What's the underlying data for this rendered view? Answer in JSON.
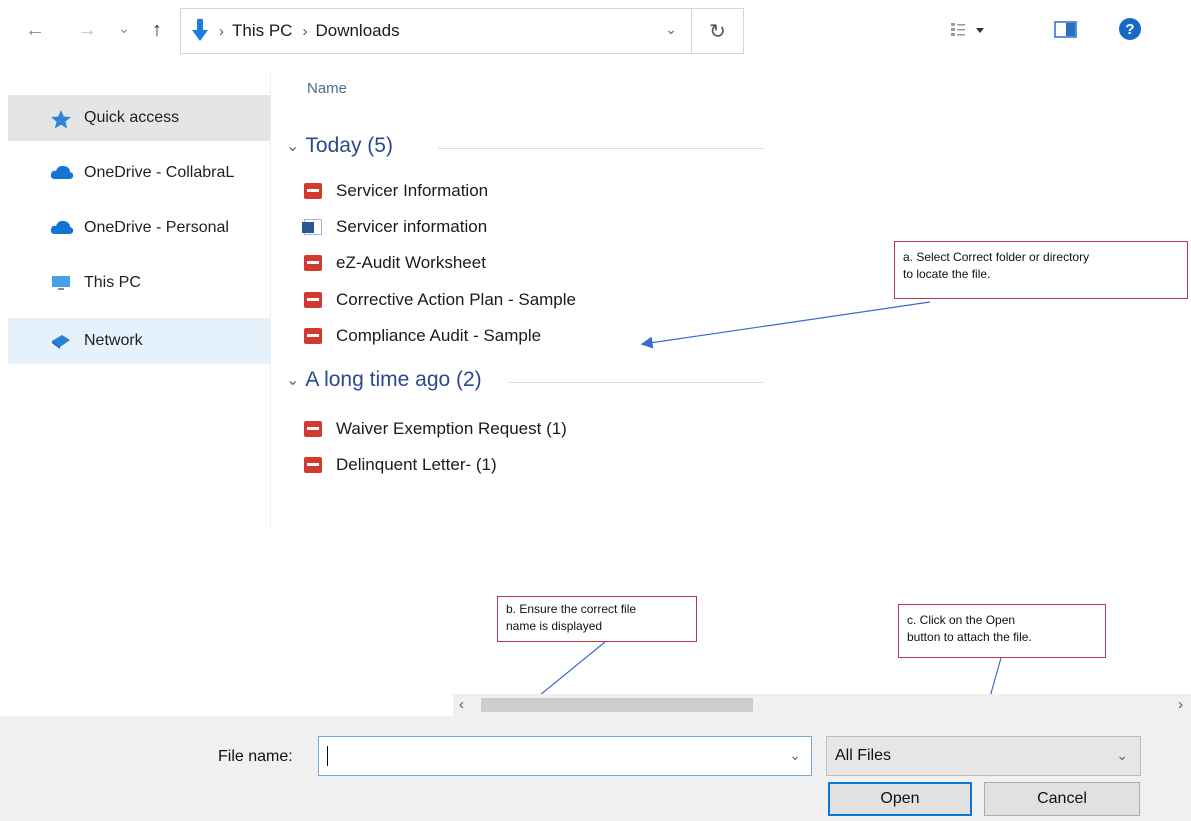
{
  "nav": {
    "back_icon": "←",
    "forward_icon": "→",
    "recent_icon": "⌄",
    "up_icon": "↑",
    "refresh_icon": "↻",
    "dropdown_icon": "⌄"
  },
  "address": {
    "separator": "›",
    "crumbs": [
      "This PC",
      "Downloads"
    ]
  },
  "sidebar": {
    "items": [
      {
        "label": "Quick access",
        "icon": "star-icon"
      },
      {
        "label": "OneDrive - CollabraL",
        "icon": "cloud-icon"
      },
      {
        "label": "OneDrive - Personal",
        "icon": "cloud-icon"
      },
      {
        "label": "This PC",
        "icon": "computer-icon"
      },
      {
        "label": "Network",
        "icon": "network-icon"
      }
    ]
  },
  "list": {
    "column_header": "Name",
    "groups": [
      {
        "title": "Today (5)",
        "files": [
          {
            "name": "Servicer Information",
            "type": "pdf"
          },
          {
            "name": "Servicer information",
            "type": "word"
          },
          {
            "name": "eZ-Audit Worksheet",
            "type": "pdf"
          },
          {
            "name": "Corrective Action Plan - Sample",
            "type": "pdf"
          },
          {
            "name": "Compliance Audit - Sample",
            "type": "pdf"
          }
        ]
      },
      {
        "title": "A long time ago (2)",
        "files": [
          {
            "name": "Waiver Exemption Request (1)",
            "type": "pdf"
          },
          {
            "name": "Delinquent Letter- (1)",
            "type": "pdf"
          }
        ]
      }
    ]
  },
  "annotations": {
    "a": {
      "line1": "a. Select Correct folder or directory",
      "line2": "to locate the file."
    },
    "b": {
      "line1": "b. Ensure the correct file",
      "line2": "name is displayed"
    },
    "c": {
      "line1": "c. Click on the Open",
      "line2": "button to attach the file."
    }
  },
  "footer": {
    "file_name_label": "File name:",
    "file_name_value": "",
    "file_type_value": "All Files",
    "open_label": "Open",
    "cancel_label": "Cancel",
    "scroll_left": "‹",
    "scroll_right": "›"
  },
  "colors": {
    "accent": "#0a78d7",
    "callout_border": "#b4394d",
    "annotation_arrow": "#3b6cc9",
    "pdf_icon": "#d23a30",
    "word_icon": "#2b579a",
    "selected_item": "#e5e5e5",
    "hover_item": "#e5f1fb"
  }
}
